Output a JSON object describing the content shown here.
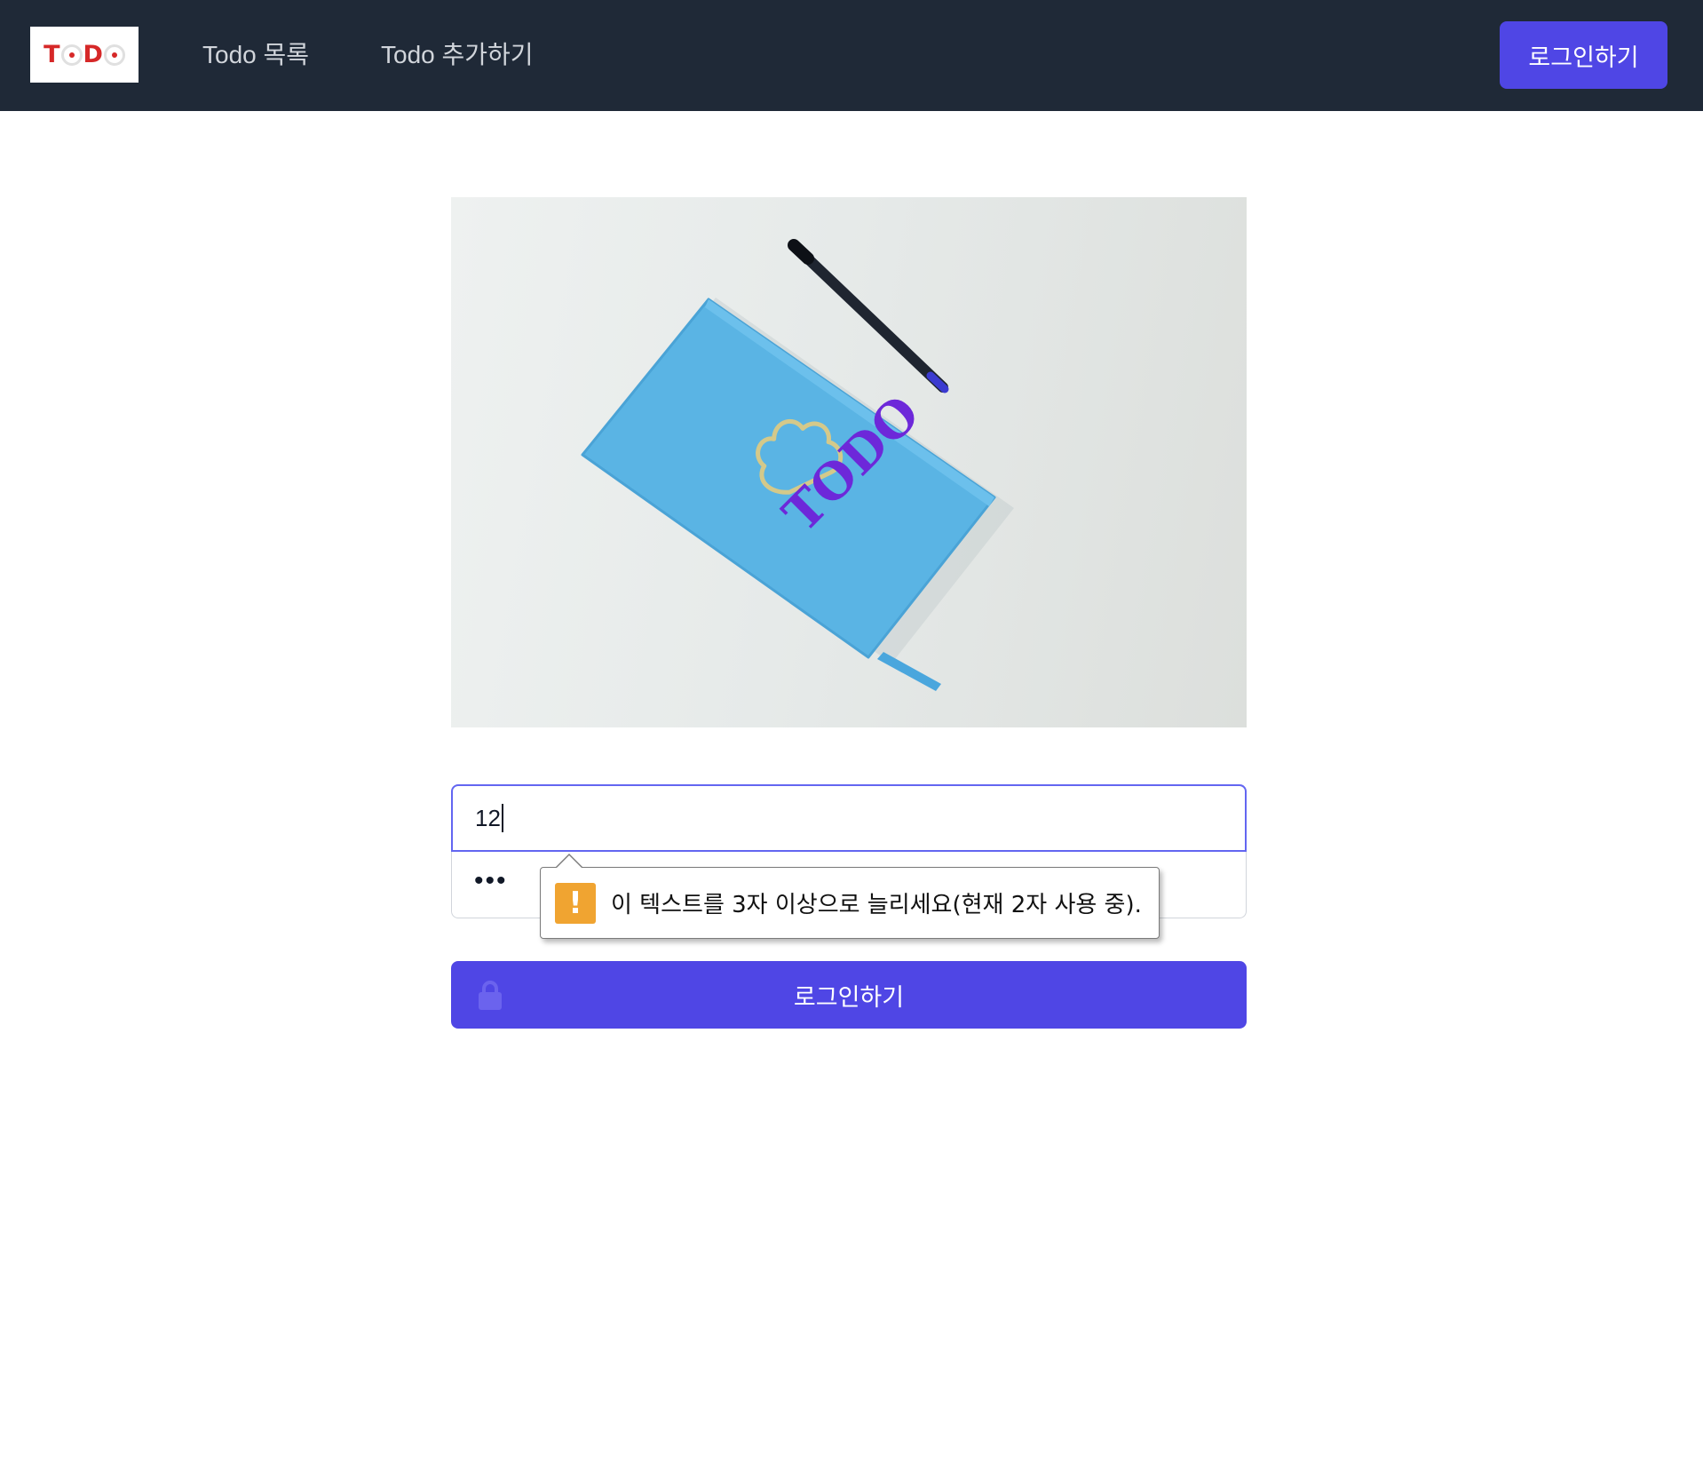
{
  "header": {
    "logo_text": "TODO",
    "nav": {
      "list_label": "Todo 목록",
      "add_label": "Todo 추가하기"
    },
    "login_label": "로그인하기"
  },
  "hero": {
    "image_icon": "notebook-photo",
    "cover_text": "TODO"
  },
  "form": {
    "id_value": "12",
    "password_value": "•••",
    "validation": {
      "icon": "warning-icon",
      "message": "이 텍스트를 3자 이상으로 늘리세요(현재 2자 사용 중)."
    },
    "submit_label": "로그인하기",
    "submit_icon": "lock-icon"
  },
  "colors": {
    "navbar": "#1f2937",
    "accent": "#4f46e5",
    "focus_border": "#6366f1",
    "warning": "#f0a431",
    "notebook": "#5ab4e4",
    "cover_text": "#6d28d9"
  }
}
